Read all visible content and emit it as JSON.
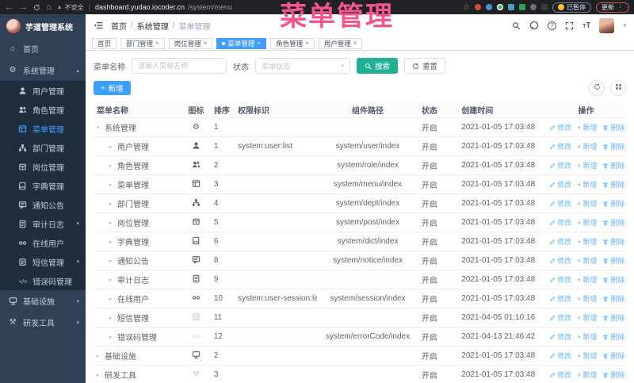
{
  "browser": {
    "warning": "不安全",
    "url_domain": "dashboard.yudao.iocoder.cn",
    "url_path": "/system/menu",
    "paused_label": "已暂停",
    "update_label": "更新"
  },
  "annotation": {
    "text": "菜单管理",
    "color": "#f4558e"
  },
  "colors": {
    "accent": "#409eff",
    "search_button": "#21b095",
    "link": "#66b1ff",
    "sidebar_bg": "#304156",
    "submenu_bg": "#1f2d3d"
  },
  "sidebar": {
    "logo_title": "芋道管理系统",
    "menu": [
      {
        "label": "首页",
        "icon": "home",
        "level": 0
      },
      {
        "label": "系统管理",
        "icon": "gear",
        "level": 0,
        "caret": "up"
      },
      {
        "label": "用户管理",
        "icon": "user",
        "level": 1
      },
      {
        "label": "角色管理",
        "icon": "users",
        "level": 1
      },
      {
        "label": "菜单管理",
        "icon": "menu",
        "level": 1,
        "active": true
      },
      {
        "label": "部门管理",
        "icon": "dept",
        "level": 1
      },
      {
        "label": "岗位管理",
        "icon": "post",
        "level": 1
      },
      {
        "label": "字典管理",
        "icon": "dict",
        "level": 1
      },
      {
        "label": "通知公告",
        "icon": "notice",
        "level": 1
      },
      {
        "label": "审计日志",
        "icon": "log",
        "level": 1,
        "caret": "down"
      },
      {
        "label": "在线用户",
        "icon": "online",
        "level": 1
      },
      {
        "label": "短信管理",
        "icon": "sms",
        "level": 1,
        "caret": "down"
      },
      {
        "label": "错误码管理",
        "icon": "code",
        "level": 1
      },
      {
        "label": "基础设施",
        "icon": "infra",
        "level": 0,
        "caret": "down"
      },
      {
        "label": "研发工具",
        "icon": "tool",
        "level": 0,
        "caret": "down"
      }
    ]
  },
  "header": {
    "breadcrumb": [
      "首页",
      "系统管理",
      "菜单管理"
    ]
  },
  "tabs": [
    {
      "label": "首页",
      "active": false,
      "closable": false
    },
    {
      "label": "部门管理",
      "active": false,
      "closable": true
    },
    {
      "label": "岗位管理",
      "active": false,
      "closable": true
    },
    {
      "label": "菜单管理",
      "active": true,
      "closable": true
    },
    {
      "label": "角色管理",
      "active": false,
      "closable": true
    },
    {
      "label": "用户管理",
      "active": false,
      "closable": true
    }
  ],
  "filter": {
    "name_label": "菜单名称",
    "name_placeholder": "请输入菜单名称",
    "status_label": "状态",
    "status_placeholder": "菜单状态",
    "search_label": "搜索",
    "reset_label": "重置"
  },
  "toolbar": {
    "add_label": "新增"
  },
  "table": {
    "columns": [
      "菜单名称",
      "图标",
      "排序",
      "权限标识",
      "组件路径",
      "状态",
      "创建时间",
      "操作"
    ],
    "action_labels": {
      "edit": "修改",
      "add": "新增",
      "delete": "删除"
    },
    "rows": [
      {
        "name": "系统管理",
        "level": 0,
        "caret": "down",
        "icon": "gear",
        "sort": "1",
        "perm": "",
        "component": "",
        "status": "开启",
        "created": "2021-01-05 17:03:48"
      },
      {
        "name": "用户管理",
        "level": 1,
        "caret": "right",
        "icon": "user",
        "sort": "1",
        "perm": "system:user:list",
        "component": "system/user/index",
        "status": "开启",
        "created": "2021-01-05 17:03:48"
      },
      {
        "name": "角色管理",
        "level": 1,
        "caret": "right",
        "icon": "users",
        "sort": "2",
        "perm": "",
        "component": "system/role/index",
        "status": "开启",
        "created": "2021-01-05 17:03:48"
      },
      {
        "name": "菜单管理",
        "level": 1,
        "caret": "right",
        "icon": "menu",
        "sort": "3",
        "perm": "",
        "component": "system/menu/index",
        "status": "开启",
        "created": "2021-01-05 17:03:48"
      },
      {
        "name": "部门管理",
        "level": 1,
        "caret": "right",
        "icon": "dept",
        "sort": "4",
        "perm": "",
        "component": "system/dept/index",
        "status": "开启",
        "created": "2021-01-05 17:03:48"
      },
      {
        "name": "岗位管理",
        "level": 1,
        "caret": "right",
        "icon": "post",
        "sort": "5",
        "perm": "",
        "component": "system/post/index",
        "status": "开启",
        "created": "2021-01-05 17:03:48"
      },
      {
        "name": "字典管理",
        "level": 1,
        "caret": "right",
        "icon": "dict",
        "sort": "6",
        "perm": "",
        "component": "system/dict/index",
        "status": "开启",
        "created": "2021-01-05 17:03:48"
      },
      {
        "name": "通知公告",
        "level": 1,
        "caret": "right",
        "icon": "notice",
        "sort": "8",
        "perm": "",
        "component": "system/notice/index",
        "status": "开启",
        "created": "2021-01-05 17:03:48"
      },
      {
        "name": "审计日志",
        "level": 1,
        "caret": "right",
        "icon": "log",
        "sort": "9",
        "perm": "",
        "component": "",
        "status": "开启",
        "created": "2021-01-05 17:03:48"
      },
      {
        "name": "在线用户",
        "level": 1,
        "caret": "right",
        "icon": "online",
        "sort": "10",
        "perm": "system:user-session:list",
        "component": "system/session/index",
        "status": "开启",
        "created": "2021-01-05 17:03:48"
      },
      {
        "name": "短信管理",
        "level": 1,
        "caret": "right",
        "icon": "sms",
        "sort": "11",
        "perm": "",
        "component": "",
        "status": "开启",
        "created": "2021-04-05 01:10:16",
        "icon_muted": true
      },
      {
        "name": "错误码管理",
        "level": 1,
        "caret": "right",
        "icon": "code",
        "sort": "12",
        "perm": "",
        "component": "system/errorCode/index",
        "status": "开启",
        "created": "2021-04-13 21:46:42",
        "icon_muted": true
      },
      {
        "name": "基础设施",
        "level": 0,
        "caret": "right",
        "icon": "infra",
        "sort": "2",
        "perm": "",
        "component": "",
        "status": "开启",
        "created": "2021-01-05 17:03:48"
      },
      {
        "name": "研发工具",
        "level": 0,
        "caret": "right",
        "icon": "tool",
        "sort": "3",
        "perm": "",
        "component": "",
        "status": "开启",
        "created": "2021-01-05 17:03:48",
        "icon_muted": true
      }
    ]
  }
}
